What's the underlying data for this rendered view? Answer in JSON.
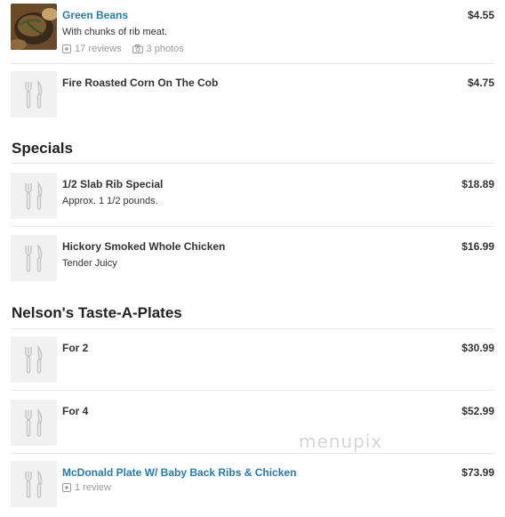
{
  "items": [
    {
      "name": "Green Beans",
      "description": "With chunks of rib meat.",
      "reviews": "17 reviews",
      "photos": "3 photos",
      "price": "$4.55"
    },
    {
      "name": "Fire Roasted Corn On The Cob",
      "price": "$4.75"
    },
    {
      "name": "1/2 Slab Rib Special",
      "description": "Approx. 1 1/2 pounds.",
      "price": "$18.89"
    },
    {
      "name": "Hickory Smoked Whole Chicken",
      "description": "Tender Juicy",
      "price": "$16.99"
    },
    {
      "name": "For 2",
      "price": "$30.99"
    },
    {
      "name": "For 4",
      "price": "$52.99"
    },
    {
      "name": "McDonald Plate W/ Baby Back Ribs & Chicken",
      "reviews": "1 review",
      "price": "$73.99"
    }
  ],
  "sections": {
    "specials": "Specials",
    "taste_plates": "Nelson's Taste-A-Plates"
  },
  "watermark": "menupix",
  "colors": {
    "link": "#1d7fb5",
    "text": "#333333",
    "muted": "#9a9a9a",
    "placeholder_bg": "#f1f1f1",
    "divider": "#e6e6e6"
  }
}
